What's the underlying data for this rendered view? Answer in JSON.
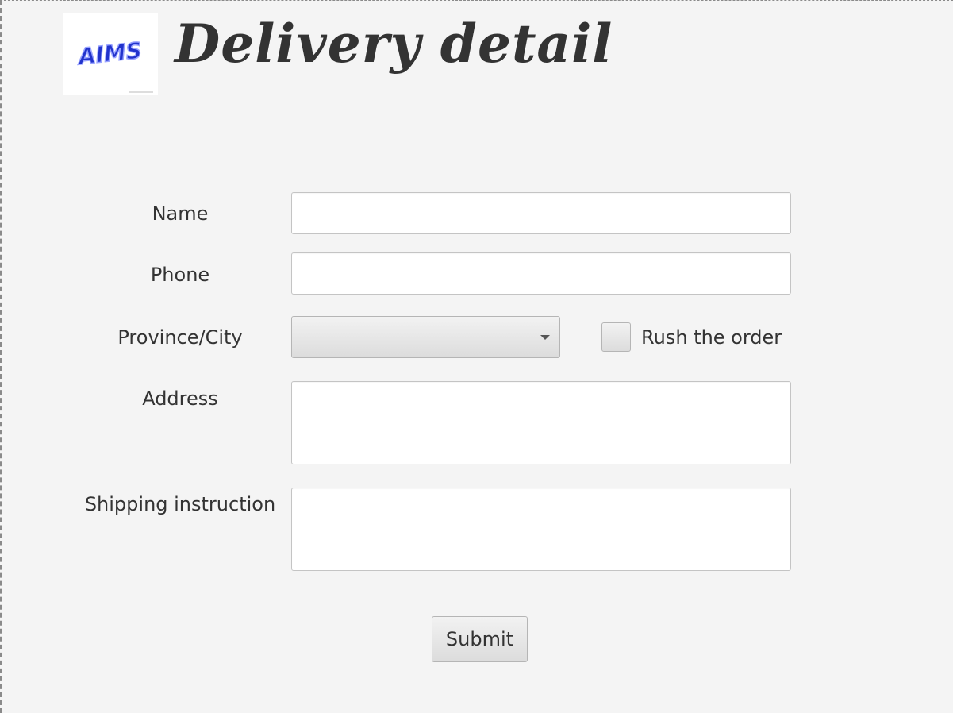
{
  "header": {
    "logo_text": "AIMS",
    "title": "Delivery detail"
  },
  "form": {
    "name_label": "Name",
    "name_value": "",
    "phone_label": "Phone",
    "phone_value": "",
    "province_label": "Province/City",
    "province_value": "",
    "rush_label": "Rush the order",
    "rush_checked": false,
    "address_label": "Address",
    "address_value": "",
    "instruction_label": "Shipping instruction",
    "instruction_value": "",
    "submit_label": "Submit"
  },
  "colors": {
    "background": "#f4f4f4",
    "text": "#333333",
    "logo_blue": "#2233cc"
  },
  "icons": {
    "combo": "chevron-down-icon",
    "logo": "aims-logo-icon"
  }
}
